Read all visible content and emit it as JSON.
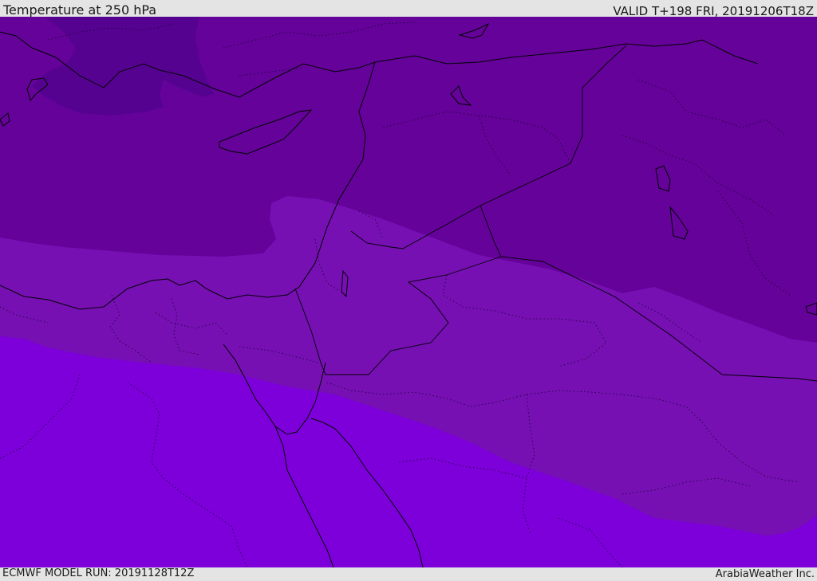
{
  "header": {
    "title": "Temperature at 250 hPa",
    "valid_time": "VALID T+198 FRI, 20191206T18Z"
  },
  "footer": {
    "model_run": "ECMWF MODEL RUN: 20191128T12Z",
    "credit": "ArabiaWeather Inc."
  },
  "colors": {
    "band_coldest": "#560291",
    "band_cold": "#65029a",
    "band_mid": "#7610b3",
    "band_warm": "#7d00db",
    "coastline": "#000000",
    "border": "#000000"
  }
}
